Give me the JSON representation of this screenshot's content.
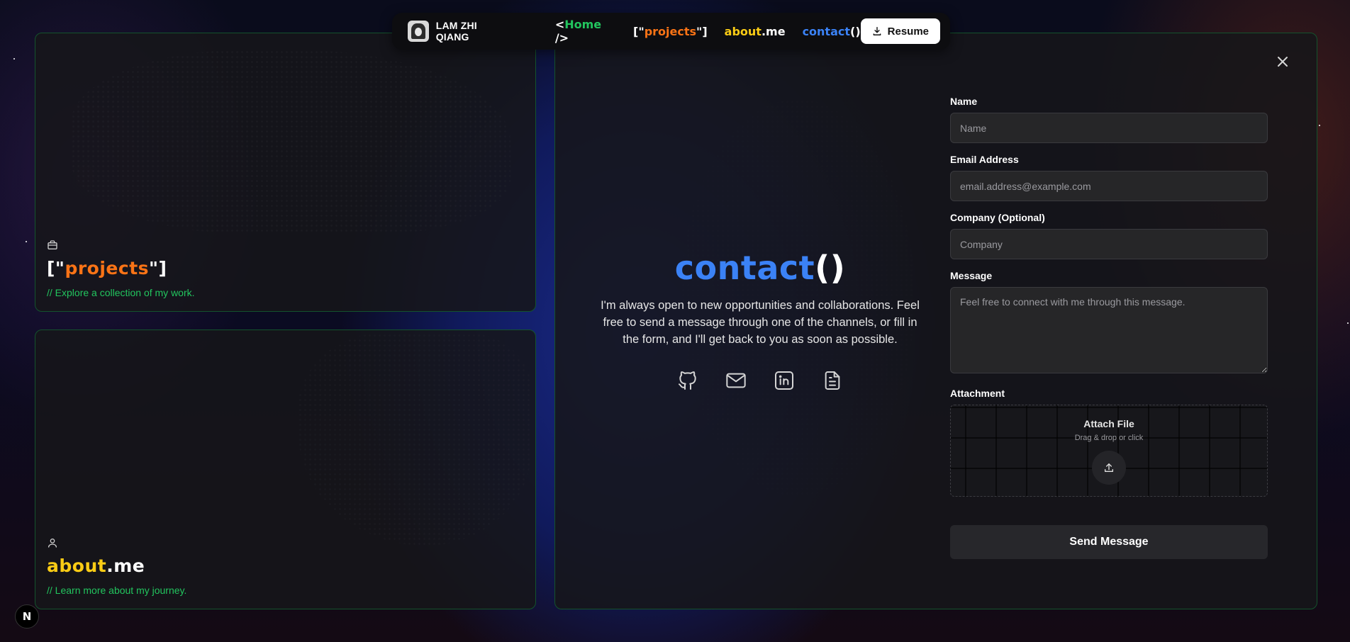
{
  "nav": {
    "brand_name": "LAM ZHI QIANG",
    "home": {
      "open": "<",
      "text": "Home",
      "close": " />"
    },
    "projects": {
      "open": "[\"",
      "text": "projects",
      "close": "\"]"
    },
    "about": {
      "a": "about",
      "b": ".me"
    },
    "contact": {
      "a": "contact",
      "b": "()"
    },
    "resume_label": "Resume"
  },
  "projects_card": {
    "title_open": "[\"",
    "title_text": "projects",
    "title_close": "\"]",
    "subtitle": "// Explore a collection of my work."
  },
  "about_card": {
    "title_a": "about",
    "title_b": ".me",
    "subtitle": "// Learn more about my journey."
  },
  "contact": {
    "title_a": "contact",
    "title_b": "()",
    "description": "I'm always open to new opportunities and collaborations. Feel free to send a message through one of the channels, or fill in the form, and I'll get back to you as soon as possible.",
    "socials": [
      "github-icon",
      "mail-icon",
      "linkedin-icon",
      "document-icon"
    ]
  },
  "form": {
    "name_label": "Name",
    "name_placeholder": "Name",
    "email_label": "Email Address",
    "email_placeholder": "email.address@example.com",
    "company_label": "Company (Optional)",
    "company_placeholder": "Company",
    "message_label": "Message",
    "message_placeholder": "Feel free to connect with me through this message.",
    "attachment_label": "Attachment",
    "attach_title": "Attach File",
    "attach_hint": "Drag & drop or click",
    "send_label": "Send Message"
  },
  "badge": "N",
  "colors": {
    "green": "#22c55e",
    "orange": "#f97316",
    "yellow": "#facc15",
    "blue": "#3b82f6",
    "border": "#14532d"
  }
}
